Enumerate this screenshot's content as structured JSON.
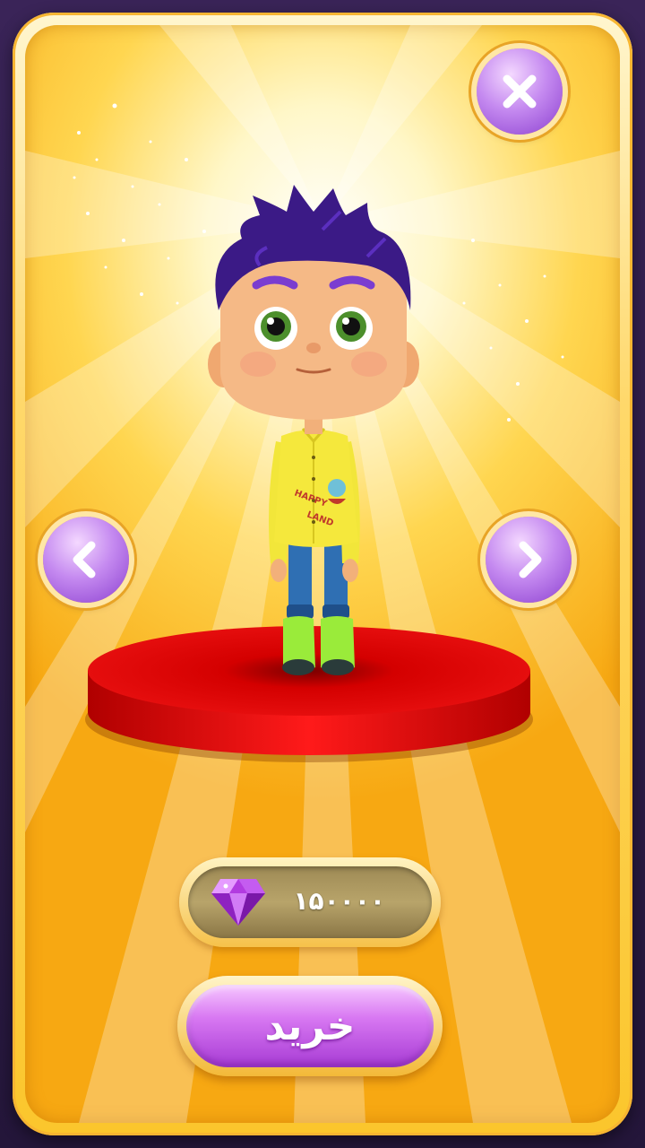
{
  "screen": {
    "name": "character-shop"
  },
  "icons": {
    "close": "close-icon",
    "previous": "chevron-left-icon",
    "next": "chevron-right-icon",
    "currency": "gem-icon"
  },
  "character": {
    "shirt_text_line1": "HAPPY",
    "shirt_text_line2": "LAND"
  },
  "price": {
    "value": "۱۵۰۰۰۰"
  },
  "buy_button": {
    "label": "خرید"
  },
  "colors": {
    "panel_gold": "#fbc62c",
    "button_purple": "#a73bd4",
    "pedestal_red": "#e00000"
  }
}
